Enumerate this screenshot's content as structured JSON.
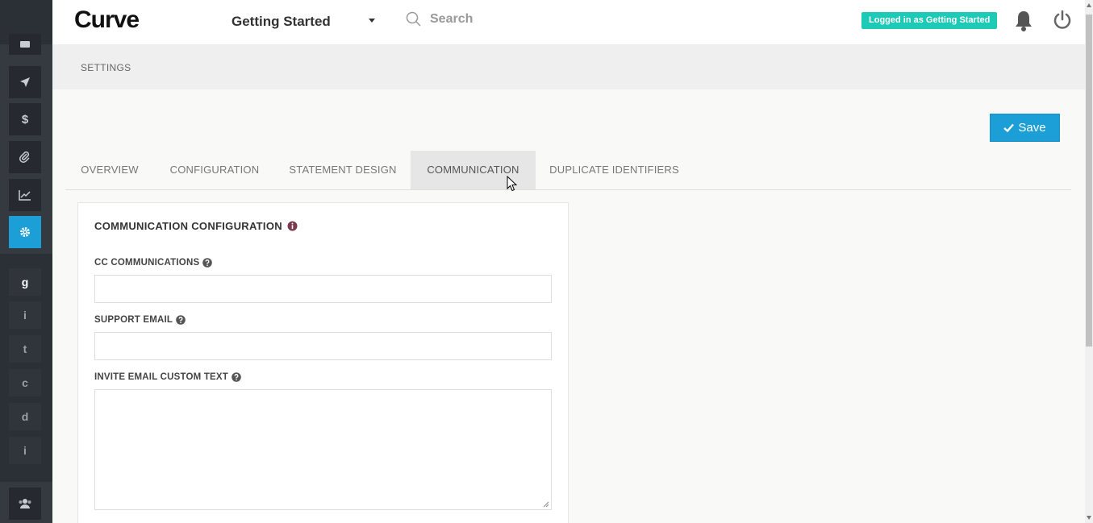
{
  "header": {
    "logo": "Curve",
    "org_name": "Getting Started",
    "search_placeholder": "Search",
    "logged_in_badge": "Logged in as Getting Started"
  },
  "sidebar": {
    "letter_items": [
      "g",
      "i",
      "t",
      "c",
      "d",
      "i"
    ],
    "dollar_label": "$"
  },
  "breadcrumb": "SETTINGS",
  "save_label": "Save",
  "tabs": [
    {
      "label": "OVERVIEW",
      "active": false
    },
    {
      "label": "CONFIGURATION",
      "active": false
    },
    {
      "label": "STATEMENT DESIGN",
      "active": false
    },
    {
      "label": "COMMUNICATION",
      "active": true
    },
    {
      "label": "DUPLICATE IDENTIFIERS",
      "active": false
    }
  ],
  "panel": {
    "title": "COMMUNICATION CONFIGURATION",
    "fields": [
      {
        "label": "CC COMMUNICATIONS",
        "value": ""
      },
      {
        "label": "SUPPORT EMAIL",
        "value": ""
      },
      {
        "label": "INVITE EMAIL CUSTOM TEXT",
        "value": ""
      }
    ]
  },
  "colors": {
    "accent": "#1c9fd6",
    "badge": "#1dc9b7",
    "sidebar": "#2b2f36"
  }
}
